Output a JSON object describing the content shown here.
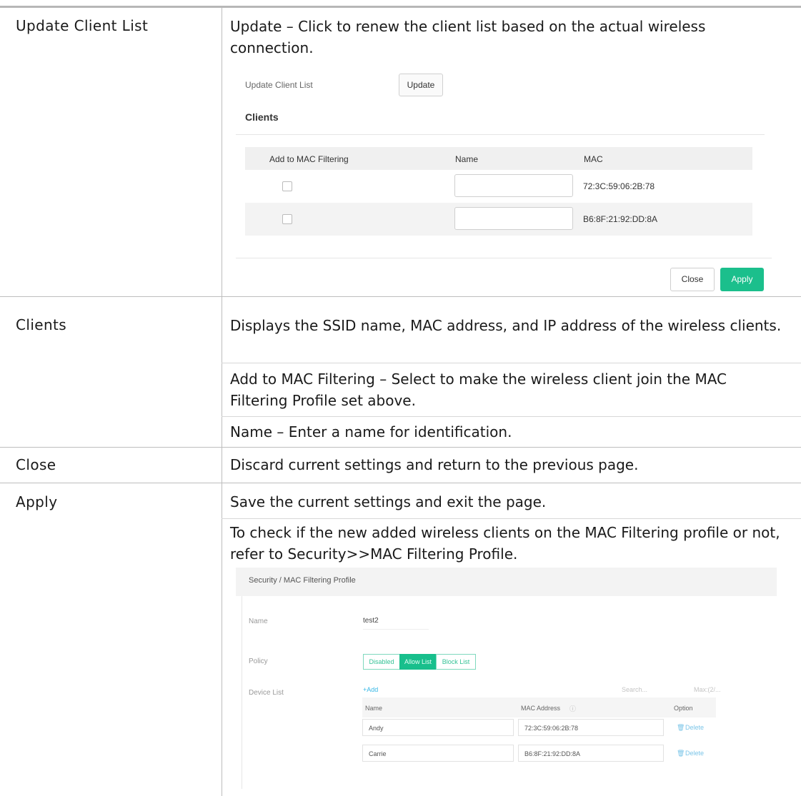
{
  "rows": [
    {
      "label": "Update Client List",
      "desc": [
        "Update – Click to renew the client list based on the actual wireless connection."
      ]
    },
    {
      "label": "Clients",
      "desc": [
        "Displays the SSID name, MAC address, and IP address of the wireless clients.",
        "Add to MAC Filtering – Select to make the wireless client join the MAC Filtering Profile set above.",
        "Name – Enter a name for identification."
      ]
    },
    {
      "label": "Close",
      "desc": [
        "Discard current settings and return to the previous page."
      ]
    },
    {
      "label": "Apply",
      "desc": [
        "Save the current settings and exit the page.",
        "To check if the new added wireless clients on the MAC Filtering profile or not, refer to Security>>MAC Filtering Profile."
      ]
    }
  ],
  "shot1": {
    "update_label": "Update Client List",
    "update_button": "Update",
    "clients_heading": "Clients",
    "columns": [
      "Add to MAC Filtering",
      "Name",
      "MAC"
    ],
    "clients": [
      {
        "mac": "72:3C:59:06:2B:78",
        "checked": false,
        "name": ""
      },
      {
        "mac": "B6:8F:21:92:DD:8A",
        "checked": false,
        "name": ""
      }
    ],
    "close_button": "Close",
    "apply_button": "Apply",
    "apply_color": "#1bbf8c"
  },
  "shot2": {
    "title": "Security / MAC Filtering Profile",
    "name_label": "Name",
    "name_value": "test2",
    "policy_label": "Policy",
    "policy_options": [
      "Disabled",
      "Allow List",
      "Block List"
    ],
    "policy_selected": "Allow List",
    "device_list_label": "Device List",
    "add_link": "+Add",
    "search_placeholder": "Search...",
    "max_text": "Max:(2/...",
    "columns": [
      "Name",
      "MAC Address",
      "Option"
    ],
    "devices": [
      {
        "name": "Andy",
        "mac": "72:3C:59:06:2B:78",
        "option": "Delete"
      },
      {
        "name": "Carrie",
        "mac": "B6:8F:21:92:DD:8A",
        "option": "Delete"
      }
    ]
  }
}
